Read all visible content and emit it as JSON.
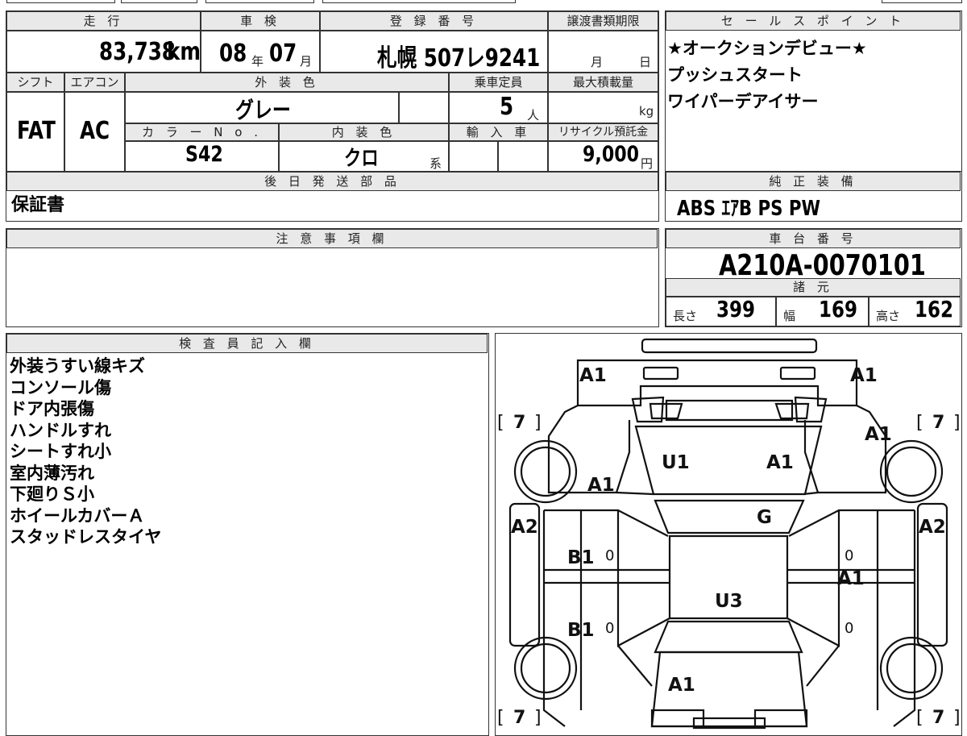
{
  "vehicle": {
    "headers": {
      "mileage": "走 行",
      "inspection": "車 検",
      "registration": "登 録 番 号",
      "transfer_deadline": "譲渡書類期限",
      "shift": "シフト",
      "aircon": "エアコン",
      "exterior_color": "外 装 色",
      "capacity": "乗車定員",
      "max_load": "最大積載量",
      "color_no": "カ ラ ー N o .",
      "interior_color": "内 装 色",
      "import": "輸 入 車",
      "recycle_fee": "リサイクル預託金"
    },
    "mileage_value": "83,738",
    "mileage_unit": "km",
    "inspection_year": "08",
    "year_label": "年",
    "inspection_month": "07",
    "month_label": "月",
    "registration_number": "札幌 507レ9241",
    "deadline_month_label": "月",
    "deadline_day_label": "日",
    "shift_value": "FAT",
    "aircon_value": "AC",
    "exterior_color_value": "グレー",
    "capacity_value": "5",
    "capacity_unit": "人",
    "max_load_unit": "kg",
    "color_no_value": "S42",
    "interior_color_value": "クロ",
    "interior_color_suffix": "系",
    "recycle_fee_value": "9,000",
    "recycle_fee_unit": "円"
  },
  "sales_points": {
    "header": "セ ー ル ス ポ イ ン ト",
    "lines": [
      "★オークションデビュー★",
      "プッシュスタート",
      "ワイパーデアイサー"
    ]
  },
  "later_parts": {
    "header": "後 日 発 送 部 品",
    "value": "保証書"
  },
  "genuine_equipment": {
    "header": "純 正 装 備",
    "value": "ABS ｴｱB PS PW"
  },
  "notices": {
    "header": "注 意 事 項 欄"
  },
  "chassis": {
    "header": "車 台 番 号",
    "value": "A210A-0070101"
  },
  "specs": {
    "header": "諸 元",
    "length_label": "長さ",
    "length": "399",
    "width_label": "幅",
    "width": "169",
    "height_label": "高さ",
    "height": "162"
  },
  "inspector": {
    "header": "検 査 員 記 入 欄",
    "lines": [
      "外装うすい線キズ",
      "コンソール傷",
      "ドア内張傷",
      "ハンドルすれ",
      "シートすれ小",
      "室内薄汚れ",
      "下廻りＳ小",
      "ホイールカバーＡ",
      "スタッドレスタイヤ"
    ]
  },
  "diagram": {
    "marks": {
      "front_left_corner": "A1",
      "front_right_corner": "A1",
      "front_right_fender": "A1",
      "windshield_left": "U1",
      "windshield_right": "A1",
      "front_left_fender": "A1",
      "roof_front": "G",
      "left_side_panel": "A2",
      "right_side_panel": "A2",
      "left_front_door": "B1",
      "left_rear_door": "B1",
      "right_side_door": "A1",
      "roof_center": "U3",
      "rear_hatch": "A1"
    },
    "tire_tread": [
      "7",
      "7",
      "7",
      "7"
    ],
    "door_zero_marks": [
      "0",
      "0",
      "0",
      "0"
    ]
  }
}
